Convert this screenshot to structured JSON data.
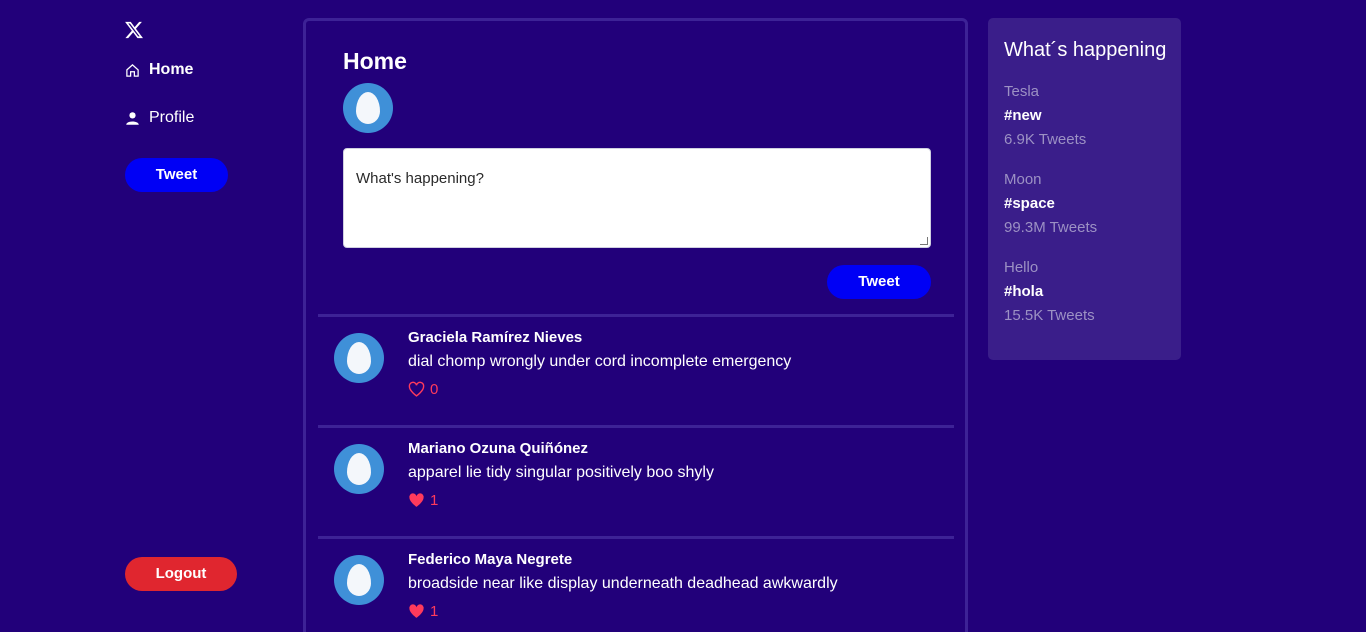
{
  "sidebar": {
    "logo_icon": "x-logo-icon",
    "items": [
      {
        "label": "Home",
        "icon": "home-icon"
      },
      {
        "label": "Profile",
        "icon": "user-icon"
      }
    ],
    "tweet_button": "Tweet",
    "logout_button": "Logout"
  },
  "main": {
    "title": "Home",
    "compose": {
      "placeholder": "What's happening?",
      "tweet_button": "Tweet"
    },
    "tweets": [
      {
        "author": "Graciela Ramírez Nieves",
        "text": "dial chomp wrongly under cord incomplete emergency",
        "likes": "0",
        "liked": false
      },
      {
        "author": "Mariano Ozuna Quiñónez",
        "text": "apparel lie tidy singular positively boo shyly",
        "likes": "1",
        "liked": true
      },
      {
        "author": "Federico Maya Negrete",
        "text": "broadside near like display underneath deadhead awkwardly",
        "likes": "1",
        "liked": true
      }
    ]
  },
  "trends": {
    "title": "What´s happening",
    "items": [
      {
        "topic": "Tesla",
        "tag": "#new",
        "count": "6.9K Tweets"
      },
      {
        "topic": "Moon",
        "tag": "#space",
        "count": "99.3M Tweets"
      },
      {
        "topic": "Hello",
        "tag": "#hola",
        "count": "15.5K Tweets"
      }
    ]
  },
  "colors": {
    "background": "#22007a",
    "accent": "#0000f5",
    "danger": "#e0262f",
    "like": "#ff3a5c",
    "panel": "#3a1e8a"
  }
}
